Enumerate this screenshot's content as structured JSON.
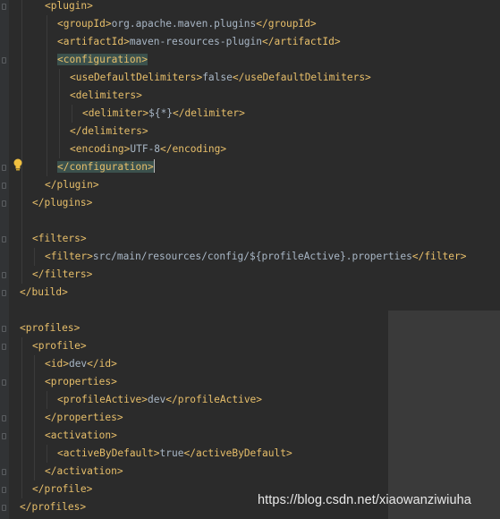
{
  "editor": {
    "watermark": "https://blog.csdn.net/xiaowanziwiuha",
    "lines": [
      {
        "parts": [
          {
            "t": "<plugin>",
            "c": "tag"
          }
        ]
      },
      {
        "parts": [
          {
            "t": "<groupId>",
            "c": "tag"
          },
          {
            "t": "org.apache.maven.plugins",
            "c": "text"
          },
          {
            "t": "</groupId>",
            "c": "tag"
          }
        ]
      },
      {
        "parts": [
          {
            "t": "<artifactId>",
            "c": "tag"
          },
          {
            "t": "maven-resources-plugin",
            "c": "text"
          },
          {
            "t": "</artifactId>",
            "c": "tag"
          }
        ]
      },
      {
        "parts": [
          {
            "t": "<configuration>",
            "c": "tag hl-tag"
          }
        ]
      },
      {
        "parts": [
          {
            "t": "<useDefaultDelimiters>",
            "c": "tag"
          },
          {
            "t": "false",
            "c": "text"
          },
          {
            "t": "</useDefaultDelimiters>",
            "c": "tag"
          }
        ]
      },
      {
        "parts": [
          {
            "t": "<delimiters>",
            "c": "tag"
          }
        ]
      },
      {
        "parts": [
          {
            "t": "<delimiter>",
            "c": "tag"
          },
          {
            "t": "${*}",
            "c": "text"
          },
          {
            "t": "</delimiter>",
            "c": "tag"
          }
        ]
      },
      {
        "parts": [
          {
            "t": "</delimiters>",
            "c": "tag"
          }
        ]
      },
      {
        "parts": [
          {
            "t": "<encoding>",
            "c": "tag"
          },
          {
            "t": "UTF-8",
            "c": "text"
          },
          {
            "t": "</encoding>",
            "c": "tag"
          }
        ]
      },
      {
        "parts": [
          {
            "t": "</configuration>",
            "c": "tag hl-tag"
          }
        ],
        "caret": true
      },
      {
        "parts": [
          {
            "t": "</plugin>",
            "c": "tag"
          }
        ]
      },
      {
        "parts": [
          {
            "t": "</plugins>",
            "c": "tag"
          }
        ]
      },
      {
        "parts": []
      },
      {
        "parts": [
          {
            "t": "<filters>",
            "c": "tag"
          }
        ]
      },
      {
        "parts": [
          {
            "t": "<filter>",
            "c": "tag"
          },
          {
            "t": "src/main/resources/config/${profileActive}.properties",
            "c": "text"
          },
          {
            "t": "</filter>",
            "c": "tag"
          }
        ]
      },
      {
        "parts": [
          {
            "t": "</filters>",
            "c": "tag"
          }
        ]
      },
      {
        "parts": [
          {
            "t": "</build>",
            "c": "tag"
          }
        ]
      },
      {
        "parts": []
      },
      {
        "parts": [
          {
            "t": "<profiles>",
            "c": "tag"
          }
        ]
      },
      {
        "parts": [
          {
            "t": "<profile>",
            "c": "tag"
          }
        ]
      },
      {
        "parts": [
          {
            "t": "<id>",
            "c": "tag"
          },
          {
            "t": "dev",
            "c": "text"
          },
          {
            "t": "</id>",
            "c": "tag"
          }
        ]
      },
      {
        "parts": [
          {
            "t": "<properties>",
            "c": "tag"
          }
        ]
      },
      {
        "parts": [
          {
            "t": "<profileActive>",
            "c": "tag"
          },
          {
            "t": "dev",
            "c": "text"
          },
          {
            "t": "</profileActive>",
            "c": "tag"
          }
        ]
      },
      {
        "parts": [
          {
            "t": "</properties>",
            "c": "tag"
          }
        ]
      },
      {
        "parts": [
          {
            "t": "<activation>",
            "c": "tag"
          }
        ]
      },
      {
        "parts": [
          {
            "t": "<activeByDefault>",
            "c": "tag"
          },
          {
            "t": "true",
            "c": "text"
          },
          {
            "t": "</activeByDefault>",
            "c": "tag"
          }
        ]
      },
      {
        "parts": [
          {
            "t": "</activation>",
            "c": "tag"
          }
        ]
      },
      {
        "parts": [
          {
            "t": "</profile>",
            "c": "tag"
          }
        ]
      },
      {
        "parts": [
          {
            "t": "</profiles>",
            "c": "tag"
          }
        ]
      }
    ]
  },
  "colors": {
    "background": "#2b2b2b",
    "tag": "#e8bf6a",
    "text": "#a9b7c6",
    "highlight": "#3b514d",
    "bulb": "#f0c040"
  },
  "icons": {
    "intention": "lightbulb-icon"
  }
}
